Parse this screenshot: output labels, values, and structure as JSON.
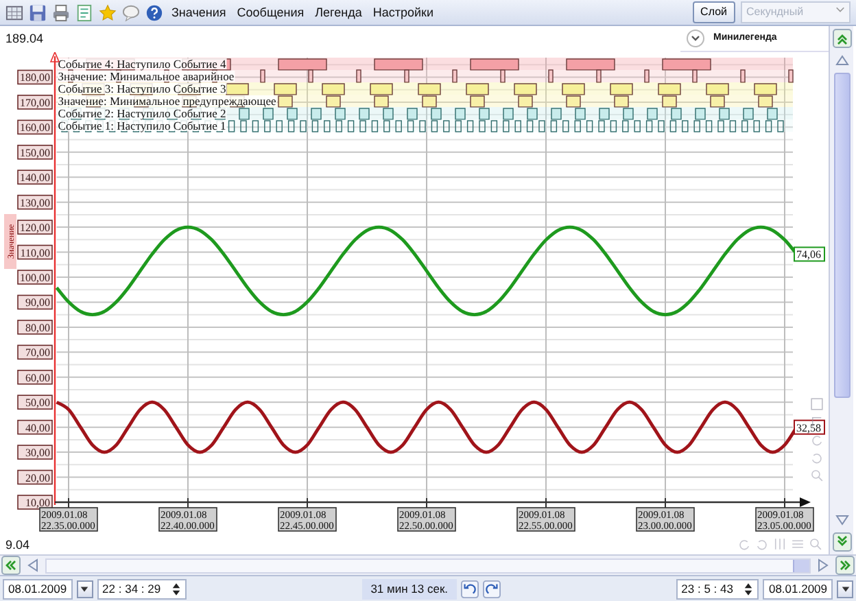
{
  "toolbar": {
    "menu": [
      "Значения",
      "Сообщения",
      "Легенда",
      "Настройки"
    ],
    "layer_button": "Слой",
    "scale_select": {
      "value": "Секундный",
      "disabled": true
    }
  },
  "minilegend": {
    "title": "Минилегенда",
    "expanded": false
  },
  "chart": {
    "top_value": "189.04",
    "bottom_value": "9.04",
    "event_lanes": [
      {
        "label": "Событие 4: Наступило Событие 4",
        "color": "#f4a0a6"
      },
      {
        "label": "Значение: Минимальное аварийное",
        "color": "#f6c6c8"
      },
      {
        "label": "Событие 3: Наступило Событие 3",
        "color": "#f6f09a"
      },
      {
        "label": "Значение: Минимальное предупреждающее",
        "color": "#f8f0a8"
      },
      {
        "label": "Событие 2: Наступило Событие 2",
        "color": "#c8ecec"
      },
      {
        "label": "Событие 1: Наступило Событие 1",
        "color": "#e6f6f6"
      }
    ],
    "end_labels": [
      {
        "text": "74,06",
        "color": "#1e9a1e"
      },
      {
        "text": "32,58",
        "color": "#a0141a"
      }
    ],
    "chart_data": {
      "type": "line",
      "grid": true,
      "ylabel": "Значение",
      "ylim": [
        9.04,
        189.04
      ],
      "yticks": [
        {
          "value": 10,
          "label": "10,00"
        },
        {
          "value": 20,
          "label": "20,00"
        },
        {
          "value": 30,
          "label": "30,00"
        },
        {
          "value": 40,
          "label": "40,00"
        },
        {
          "value": 50,
          "label": "50,00"
        },
        {
          "value": 60,
          "label": "60,00"
        },
        {
          "value": 70,
          "label": "70,00"
        },
        {
          "value": 80,
          "label": "80,00"
        },
        {
          "value": 90,
          "label": "90,00"
        },
        {
          "value": 100,
          "label": "100,00"
        },
        {
          "value": 110,
          "label": "110,00"
        },
        {
          "value": 120,
          "label": "120,00"
        },
        {
          "value": 130,
          "label": "130,00"
        },
        {
          "value": 140,
          "label": "140,00"
        },
        {
          "value": 150,
          "label": "150,00"
        },
        {
          "value": 160,
          "label": "160,00"
        },
        {
          "value": 170,
          "label": "170,00"
        },
        {
          "value": 180,
          "label": "180,00"
        }
      ],
      "categories": [
        null,
        "2009.01.08\n22.35.00.000",
        null,
        null,
        null,
        null,
        null,
        null,
        null,
        null,
        null,
        "2009.01.08\n22.40.00.000",
        null,
        null,
        null,
        null,
        null,
        null,
        null,
        null,
        null,
        "2009.01.08\n22.45.00.000",
        null,
        null,
        null,
        null,
        null,
        null,
        null,
        null,
        null,
        "2009.01.08\n22.50.00.000",
        null,
        null,
        null,
        null,
        null,
        null,
        null,
        null,
        null,
        "2009.01.08\n22.55.00.000",
        null,
        null,
        null,
        null,
        null,
        null,
        null,
        null,
        null,
        "2009.01.08\n23.00.00.000",
        null,
        null,
        null,
        null,
        null,
        null,
        null,
        null,
        null,
        "2009.01.08\n23.05.00.000",
        null
      ],
      "series": [
        {
          "color": "#1e9a1e",
          "values": [
            95.8,
            90.1,
            86.3,
            85,
            86.3,
            90.1,
            95.8,
            102.5,
            109.2,
            114.9,
            118.7,
            120,
            118.7,
            114.9,
            109.2,
            102.5,
            95.8,
            90.1,
            86.3,
            85,
            86.3,
            90.1,
            95.8,
            102.5,
            109.2,
            114.9,
            118.7,
            120,
            118.7,
            114.9,
            109.2,
            102.5,
            95.8,
            90.1,
            86.3,
            85,
            86.3,
            90.1,
            95.8,
            102.5,
            109.2,
            114.9,
            118.7,
            120,
            118.7,
            114.9,
            109.2,
            102.5,
            95.8,
            90.1,
            86.3,
            85,
            86.3,
            90.1,
            95.8,
            102.5,
            109.2,
            114.9,
            118.7,
            120,
            118.7,
            114.9,
            109.2
          ]
        },
        {
          "color": "#a0141a",
          "values": [
            50,
            47.1,
            40,
            32.9,
            30,
            32.9,
            40,
            47.1,
            50,
            47.1,
            40,
            32.9,
            30,
            32.9,
            40,
            47.1,
            50,
            47.1,
            40,
            32.9,
            30,
            32.9,
            40,
            47.1,
            50,
            47.1,
            40,
            32.9,
            30,
            32.9,
            40,
            47.1,
            50,
            47.1,
            40,
            32.9,
            30,
            32.9,
            40,
            47.1,
            50,
            47.1,
            40,
            32.9,
            30,
            32.9,
            40,
            47.1,
            50,
            47.1,
            40,
            32.9,
            30,
            32.9,
            40,
            47.1,
            50,
            47.1,
            40,
            32.9,
            30,
            32.9,
            40
          ]
        }
      ]
    }
  },
  "time_bar": {
    "start_date": "08.01.2009",
    "start_time": "22 : 34 : 29",
    "duration": "31 мин 13 сек.",
    "end_time": "23 : 5 : 43",
    "end_date": "08.01.2009"
  }
}
